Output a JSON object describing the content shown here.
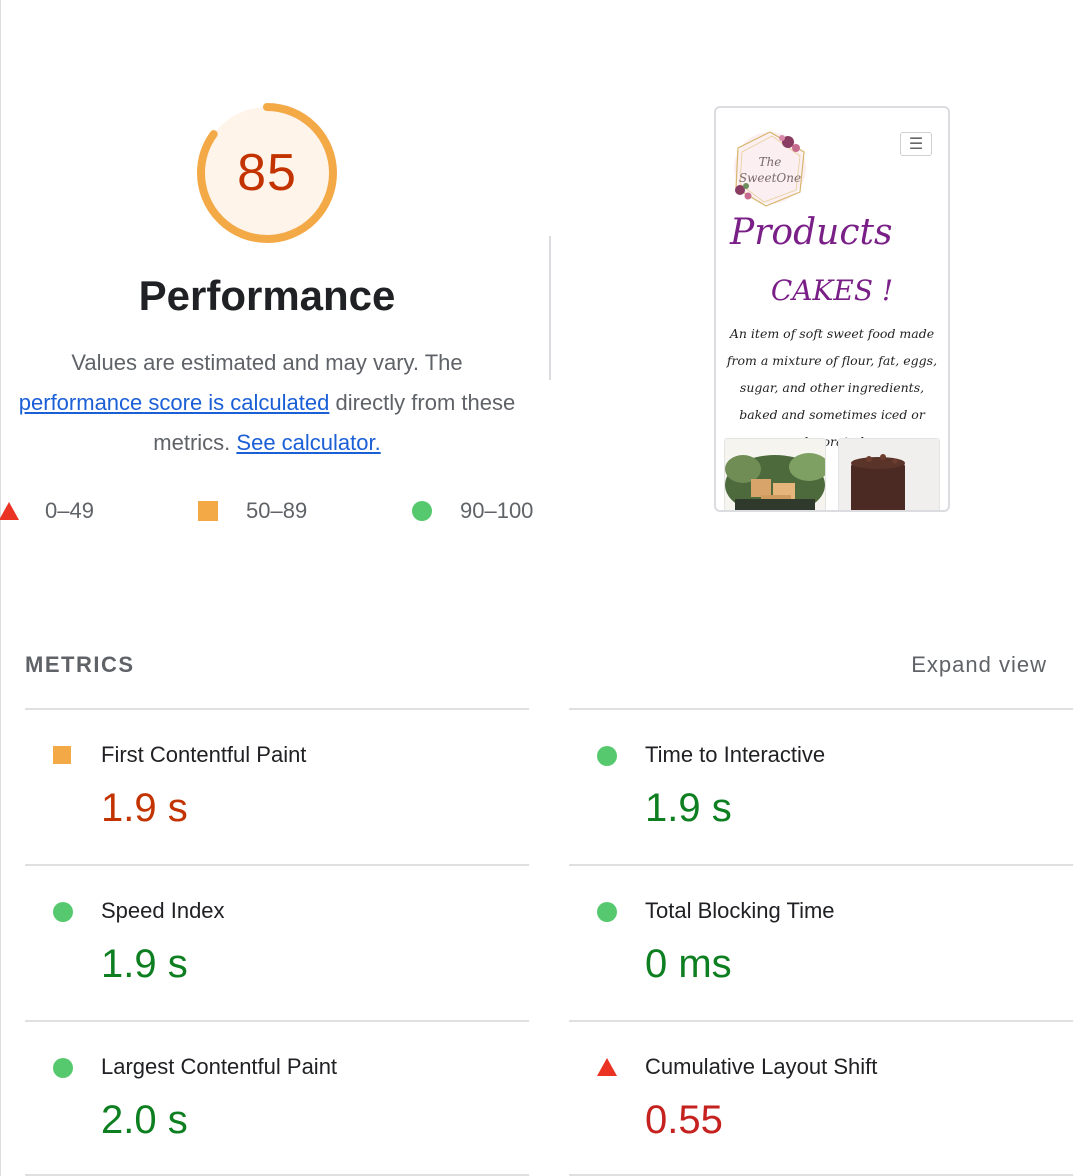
{
  "score": {
    "value": "85",
    "level": "average",
    "fraction": 0.85,
    "color": "#f4a947"
  },
  "category": {
    "title": "Performance",
    "desc_prefix": "Values are estimated and may vary. The",
    "desc_link": "performance score is calculated",
    "desc_middle": "directly from these metrics.",
    "calc_link": "See calculator."
  },
  "legend": [
    {
      "range": "0–49",
      "icon": "triangle-fail-icon",
      "color": "#eb3323"
    },
    {
      "range": "50–89",
      "icon": "square-average-icon",
      "color": "#f4a947"
    },
    {
      "range": "90–100",
      "icon": "circle-pass-icon",
      "color": "#56c96e"
    }
  ],
  "screenshot": {
    "heading": "Products",
    "subheading": "CAKES !",
    "description": "An item of soft sweet food made from a mixture of flour, fat, eggs, sugar, and other ingredients, baked and sometimes iced or decorated",
    "logo_text": "The Sweet One",
    "menu_icon": "hamburger-menu-icon"
  },
  "metrics": {
    "header": "METRICS",
    "expand": "Expand view",
    "items": [
      {
        "label": "First Contentful Paint",
        "value": "1.9 s",
        "status": "average"
      },
      {
        "label": "Time to Interactive",
        "value": "1.9 s",
        "status": "pass"
      },
      {
        "label": "Speed Index",
        "value": "1.9 s",
        "status": "pass"
      },
      {
        "label": "Total Blocking Time",
        "value": "0 ms",
        "status": "pass"
      },
      {
        "label": "Largest Contentful Paint",
        "value": "2.0 s",
        "status": "pass"
      },
      {
        "label": "Cumulative Layout Shift",
        "value": "0.55",
        "status": "fail"
      }
    ]
  }
}
